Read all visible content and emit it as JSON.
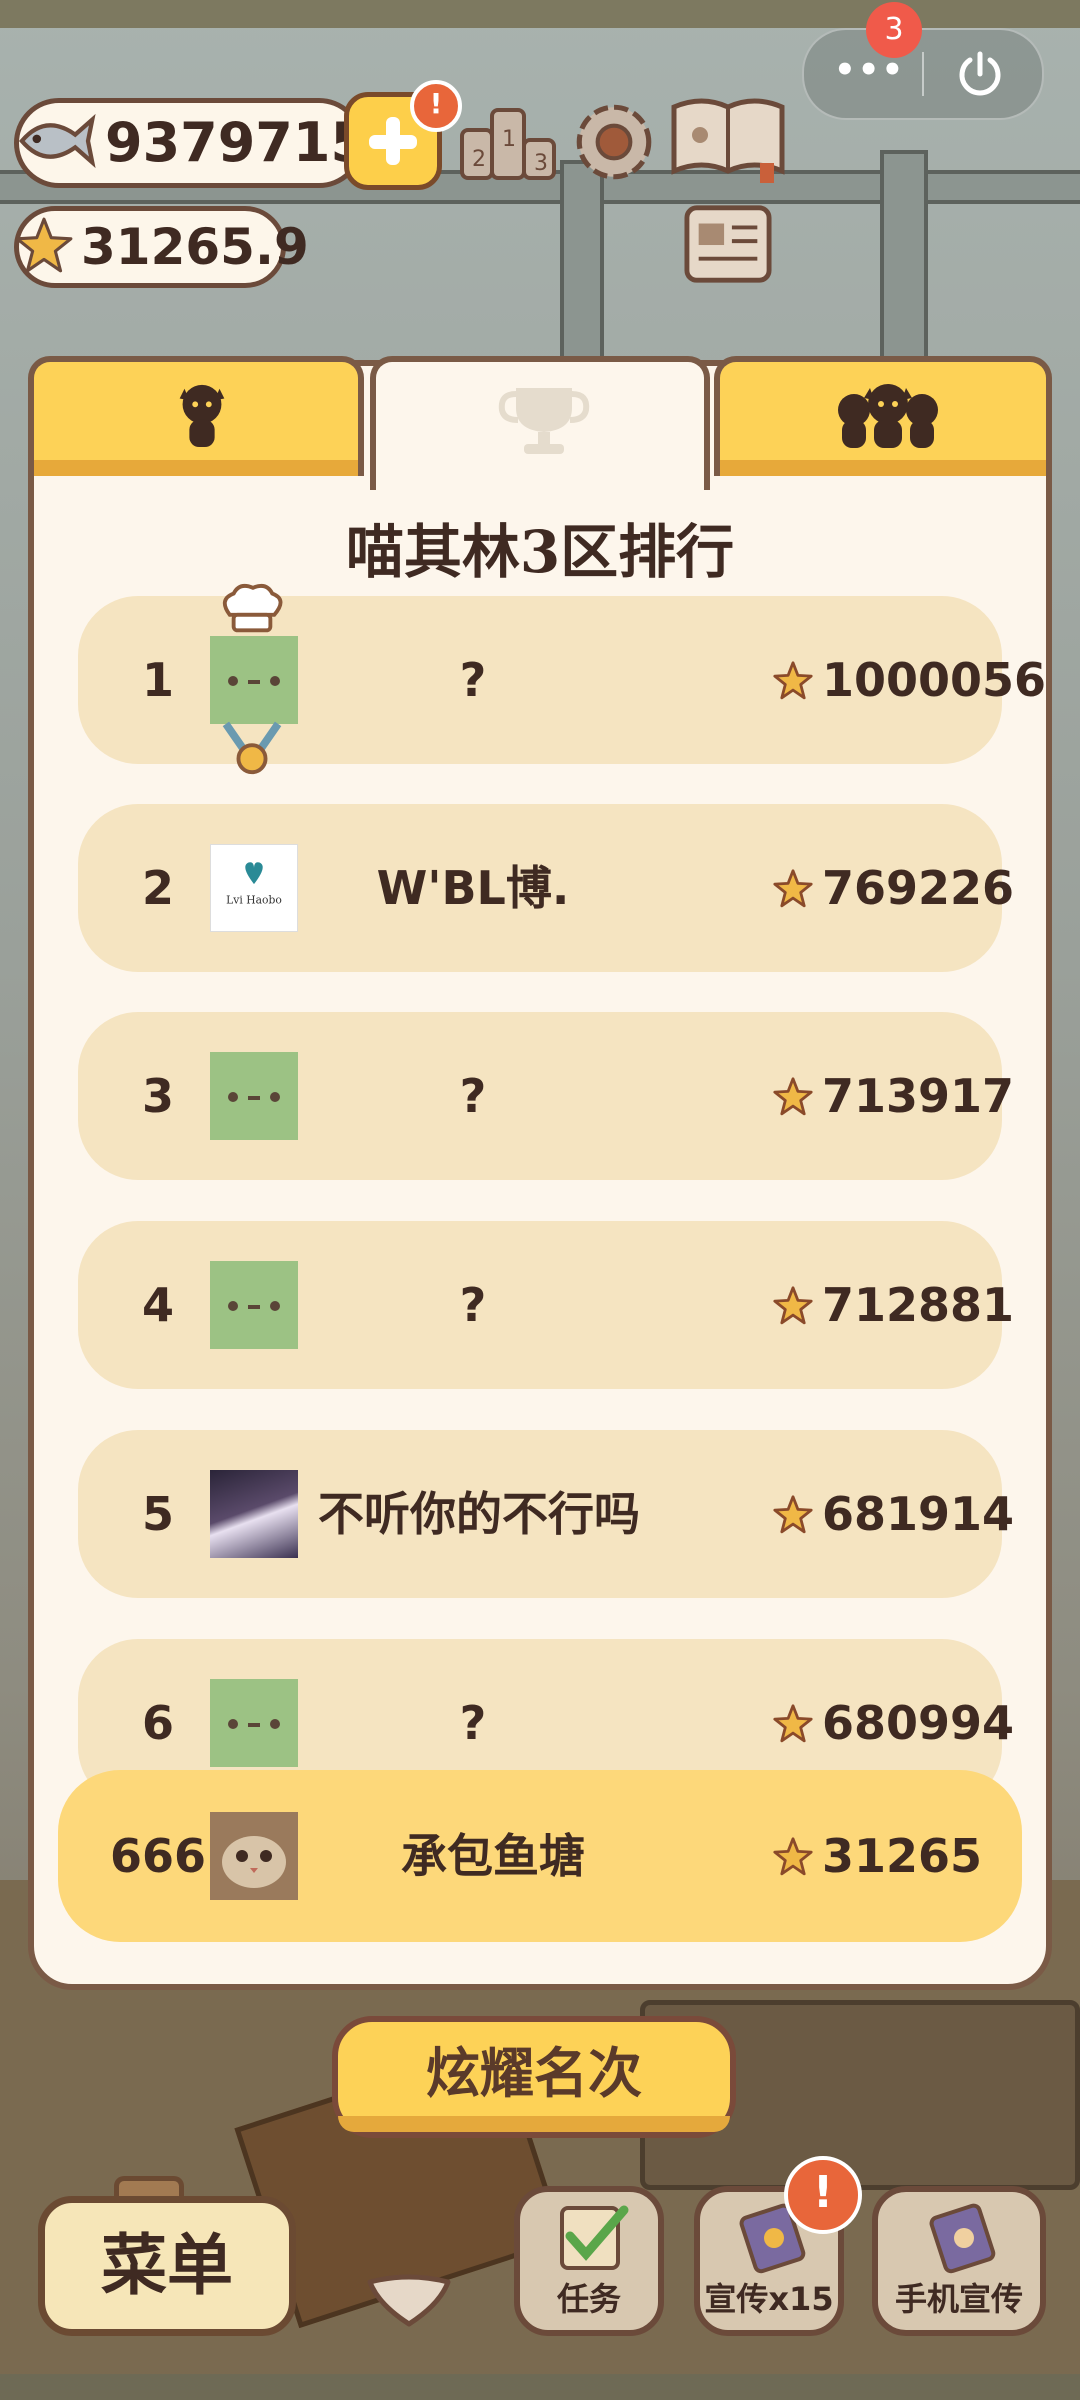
{
  "system": {
    "notification_count": "3",
    "more_icon": "more-dots-icon",
    "power_icon": "power-icon"
  },
  "currency": {
    "fish": "9379715",
    "stars": "31265.9"
  },
  "hud_icons": [
    "fish-icon",
    "star-icon",
    "add-icon",
    "podium-icon",
    "gear-icon",
    "paw-book-icon",
    "newspaper-icon"
  ],
  "tabs": [
    {
      "id": "personal",
      "icon": "single-cat-icon"
    },
    {
      "id": "ranking",
      "icon": "trophy-icon"
    },
    {
      "id": "group",
      "icon": "group-cats-icon"
    }
  ],
  "leaderboard": {
    "title": "喵其林3区排行",
    "rows": [
      {
        "rank": "1",
        "name": "?",
        "score": "1000056"
      },
      {
        "rank": "2",
        "name": "W'BL博.",
        "score": "769226"
      },
      {
        "rank": "3",
        "name": "?",
        "score": "713917"
      },
      {
        "rank": "4",
        "name": "?",
        "score": "712881"
      },
      {
        "rank": "5",
        "name": "不听你的不行吗",
        "score": "681914"
      },
      {
        "rank": "6",
        "name": "?",
        "score": "680994"
      }
    ],
    "self": {
      "rank": "666",
      "name": "承包鱼塘",
      "score": "31265"
    },
    "avatar_text": "Lvi Haobo"
  },
  "buttons": {
    "show_rank": "炫耀名次",
    "menu": "菜单",
    "task": "任务",
    "promote": "宣传x15",
    "phone_promote": "手机宣传"
  },
  "colors": {
    "tab_yellow": "#fdd257",
    "row_bg": "#f5e4c1",
    "self_row_bg": "#fdd87a",
    "outline": "#7a5a46",
    "text": "#3f2a22",
    "alert": "#e8663a"
  }
}
